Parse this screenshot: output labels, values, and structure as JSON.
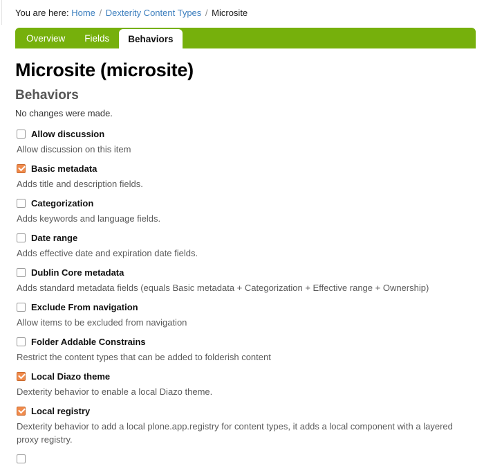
{
  "breadcrumb": {
    "label": "You are here:",
    "items": [
      {
        "text": "Home",
        "type": "link"
      },
      {
        "text": "Dexterity Content Types",
        "type": "link"
      },
      {
        "text": "Microsite",
        "type": "current"
      }
    ],
    "separator": "/"
  },
  "tabs": [
    {
      "label": "Overview",
      "active": false
    },
    {
      "label": "Fields",
      "active": false
    },
    {
      "label": "Behaviors",
      "active": true
    }
  ],
  "page": {
    "title": "Microsite (microsite)",
    "section_title": "Behaviors",
    "status_text": "No changes were made."
  },
  "colors": {
    "tabbar_green": "#76b00c",
    "link_blue": "#3a7dbd",
    "checkbox_checked_orange": "#f08a4b",
    "description_gray": "#5a5a5a"
  },
  "behaviors": [
    {
      "label": "Allow discussion",
      "description": "Allow discussion on this item",
      "checked": false
    },
    {
      "label": "Basic metadata",
      "description": "Adds title and description fields.",
      "checked": true
    },
    {
      "label": "Categorization",
      "description": "Adds keywords and language fields.",
      "checked": false
    },
    {
      "label": "Date range",
      "description": "Adds effective date and expiration date fields.",
      "checked": false
    },
    {
      "label": "Dublin Core metadata",
      "description": "Adds standard metadata fields (equals Basic metadata + Categorization + Effective range + Ownership)",
      "checked": false
    },
    {
      "label": "Exclude From navigation",
      "description": "Allow items to be excluded from navigation",
      "checked": false
    },
    {
      "label": "Folder Addable Constrains",
      "description": "Restrict the content types that can be added to folderish content",
      "checked": false
    },
    {
      "label": "Local Diazo theme",
      "description": "Dexterity behavior to enable a local Diazo theme.",
      "checked": true
    },
    {
      "label": "Local registry",
      "description": "Dexterity behavior to add a local plone.app.registry for content types, it adds a local component with a layered proxy registry.",
      "checked": true
    },
    {
      "label": "",
      "description": "",
      "checked": false
    }
  ]
}
